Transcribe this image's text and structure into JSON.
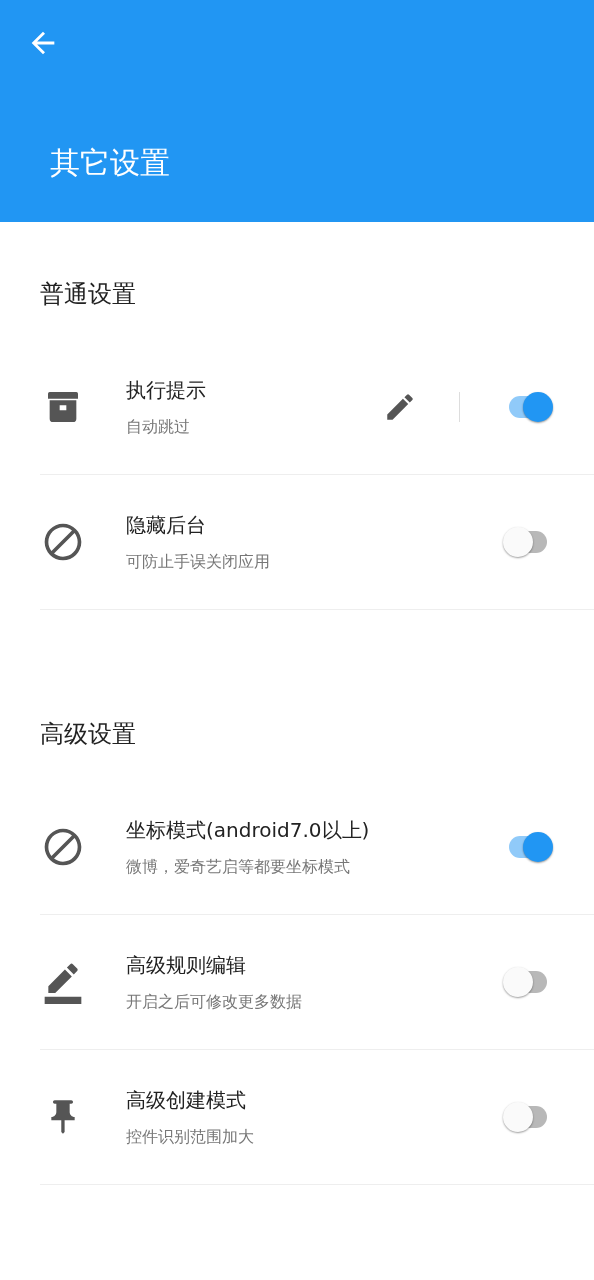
{
  "header": {
    "title": "其它设置"
  },
  "sections": [
    {
      "title": "普通设置",
      "items": [
        {
          "kind": "editable",
          "title": "执行提示",
          "subtitle": "自动跳过",
          "on": true
        },
        {
          "kind": "toggle",
          "title": "隐藏后台",
          "subtitle": "可防止手误关闭应用",
          "on": false
        }
      ]
    },
    {
      "title": "高级设置",
      "items": [
        {
          "kind": "toggle",
          "title": "坐标模式(android7.0以上)",
          "subtitle": "微博，爱奇艺启等都要坐标模式",
          "on": true
        },
        {
          "kind": "toggle",
          "title": "高级规则编辑",
          "subtitle": "开启之后可修改更多数据",
          "on": false
        },
        {
          "kind": "toggle",
          "title": "高级创建模式",
          "subtitle": "控件识别范围加大",
          "on": false
        }
      ]
    }
  ]
}
